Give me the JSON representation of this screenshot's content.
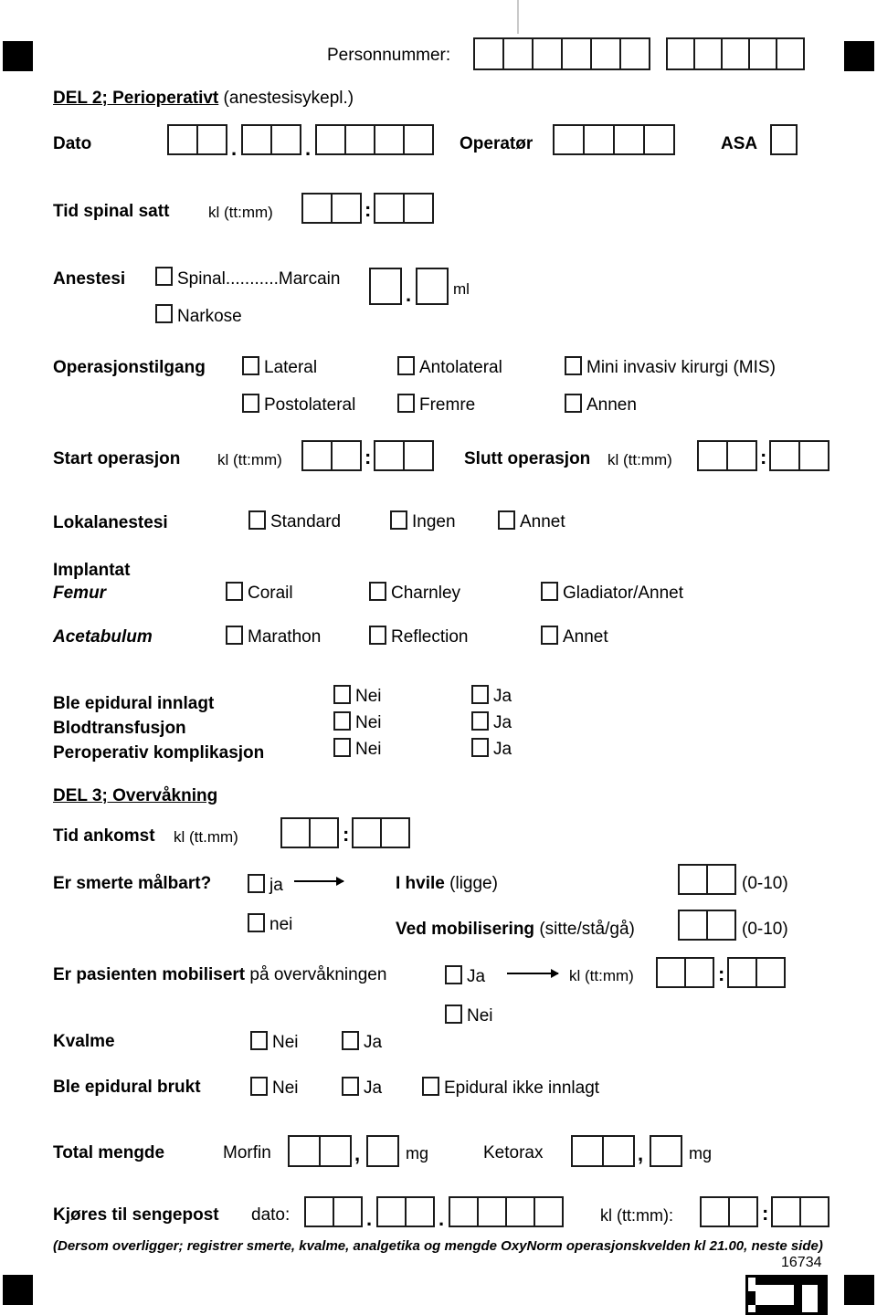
{
  "form": {
    "personnummer_label": "Personnummer:",
    "section2_title_bold": "DEL 2; Perioperativt",
    "section2_title_rest": "(anestesisykepl.)",
    "dato_label": "Dato",
    "operator_label": "Operatør",
    "asa_label": "ASA",
    "tid_spinal_label": "Tid spinal satt",
    "tid_spinal_unit": "kl (tt:mm)",
    "anestesi_label": "Anestesi",
    "anestesi_spinal": "Spinal...........Marcain",
    "anestesi_narkose": "Narkose",
    "ml_unit": "ml",
    "tilgang_label": "Operasjonstilgang",
    "tilgang_options": [
      "Lateral",
      "Antolateral",
      "Mini invasiv kirurgi (MIS)",
      "Postolateral",
      "Fremre",
      "Annen"
    ],
    "start_op_label": "Start operasjon",
    "start_op_unit": "kl (tt:mm)",
    "slutt_op_label": "Slutt operasjon",
    "slutt_op_unit": "kl (tt:mm)",
    "lokalanestesi_label": "Lokalanestesi",
    "lokalanestesi_options": [
      "Standard",
      "Ingen",
      "Annet"
    ],
    "implantat_label": "Implantat",
    "femur_label": "Femur",
    "femur_options": [
      "Corail",
      "Charnley",
      "Gladiator/Annet"
    ],
    "acetabulum_label": "Acetabulum",
    "acetabulum_options": [
      "Marathon",
      "Reflection",
      "Annet"
    ],
    "yesno_rows": [
      {
        "label": "Ble epidural innlagt",
        "no": "Nei",
        "yes": "Ja"
      },
      {
        "label": "Blodtransfusjon",
        "no": "Nei",
        "yes": "Ja"
      },
      {
        "label": "Peroperativ komplikasjon",
        "no": "Nei",
        "yes": "Ja"
      }
    ],
    "section3_title": "DEL 3; Overvåkning",
    "tid_ankomst_label": "Tid ankomst",
    "tid_ankomst_unit": "kl (tt.mm)",
    "smerte_label": "Er smerte målbart?",
    "smerte_ja": "ja",
    "smerte_nei": "nei",
    "hvile_bold": "I hvile",
    "hvile_rest": "(ligge)",
    "hvile_scale": "(0-10)",
    "mobilisering_bold": "Ved mobilisering",
    "mobilisering_rest": "(sitte/stå/gå)",
    "mobilisering_scale": "(0-10)",
    "mobilisert_bold": "Er pasienten mobilisert",
    "mobilisert_rest": "på overvåkningen",
    "mobilisert_ja": "Ja",
    "mobilisert_nei": "Nei",
    "mobilisert_unit": "kl (tt:mm)",
    "kvalme_label": "Kvalme",
    "kvalme_nei": "Nei",
    "kvalme_ja": "Ja",
    "epidural_brukt_label": "Ble epidural brukt",
    "epidural_brukt_nei": "Nei",
    "epidural_brukt_ja": "Ja",
    "epidural_ikke_innlagt": "Epidural ikke innlagt",
    "total_mengde_label": "Total mengde",
    "morfin_label": "Morfin",
    "morfin_unit": "mg",
    "ketorax_label": "Ketorax",
    "ketorax_unit": "mg",
    "comma": ",",
    "sengepost_bold": "Kjøres til sengepost",
    "sengepost_dato": "dato:",
    "sengepost_unit": "kl (tt:mm):",
    "footnote": "(Dersom overligger; registrer smerte, kvalme, analgetika og mengde OxyNorm operasjonskvelden kl 21.00, neste side)",
    "form_number": "16734",
    "dot": ".",
    "colon": ":"
  }
}
